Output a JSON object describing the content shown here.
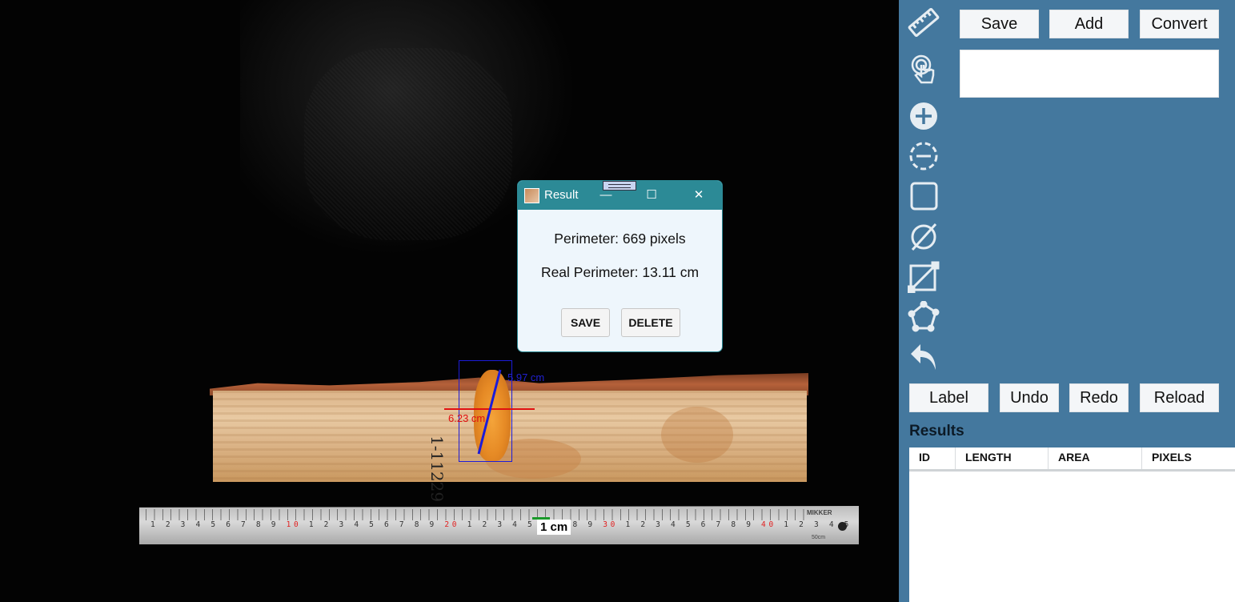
{
  "canvas": {
    "wood_writing": "1-11229",
    "measure_vertical_label": "5.97 cm",
    "measure_horizontal_label": "6.23 cm",
    "scale_label": "1 cm",
    "ruler": {
      "brand": "MIKKER",
      "end_mark": "50cm"
    }
  },
  "dialog": {
    "title": "Result",
    "perimeter_text": "Perimeter: 669 pixels",
    "real_perimeter_text": "Real Perimeter: 13.11 cm",
    "save_label": "SAVE",
    "delete_label": "DELETE",
    "minimize_glyph": "—",
    "maximize_glyph": "☐",
    "close_glyph": "✕"
  },
  "sidebar": {
    "tools": [
      {
        "name": "ruler-icon"
      },
      {
        "name": "hand-pointer-icon"
      },
      {
        "name": "plus-circle-icon"
      },
      {
        "name": "minus-circle-dashed-icon"
      },
      {
        "name": "square-icon"
      },
      {
        "name": "empty-set-icon"
      },
      {
        "name": "diagonal-box-icon"
      },
      {
        "name": "polygon-icon"
      },
      {
        "name": "undo-arrow-icon"
      }
    ],
    "top_buttons": {
      "save": "Save",
      "add": "Add",
      "convert": "Convert"
    },
    "textbox_value": "",
    "action_buttons": {
      "label": "Label",
      "undo": "Undo",
      "redo": "Redo",
      "reload": "Reload"
    },
    "results": {
      "title": "Results",
      "columns": [
        "ID",
        "LENGTH",
        "AREA",
        "PIXELS"
      ],
      "rows": []
    }
  },
  "colors": {
    "sidebar_bg": "#44789e",
    "dialog_titlebar": "#2c8a96",
    "measure_red": "#e01010",
    "measure_blue": "#1c1cd8"
  }
}
